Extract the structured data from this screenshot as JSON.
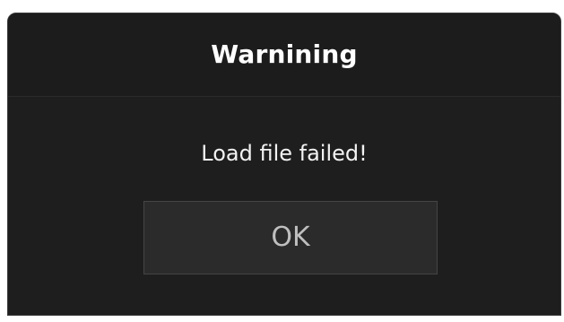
{
  "dialog": {
    "title": "Warnining",
    "message": "Load file failed!",
    "ok_label": "OK"
  }
}
